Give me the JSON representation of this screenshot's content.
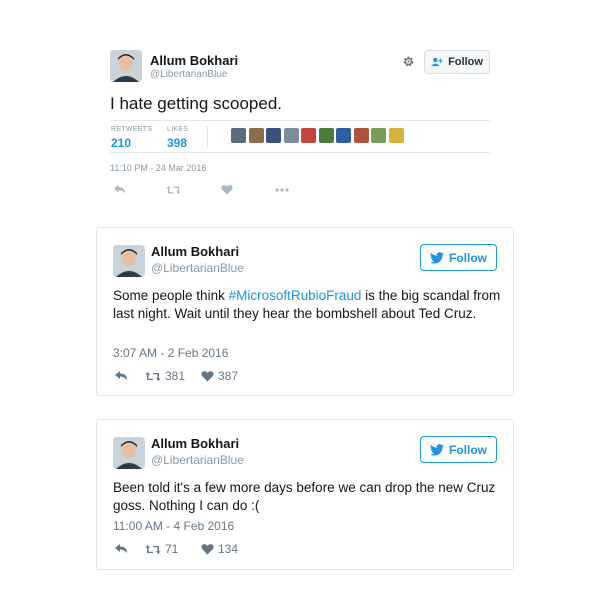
{
  "tweet_main": {
    "author": {
      "name": "Allum Bokhari",
      "handle": "@LibertarianBlue"
    },
    "follow_label": "Follow",
    "text": "I hate getting scooped.",
    "stats": {
      "retweets_label": "RETWEETS",
      "retweets_value": "210",
      "likes_label": "LIKES",
      "likes_value": "398"
    },
    "liker_avatar_colors": [
      "#5a6b7a",
      "#8a6d4c",
      "#3f4f7c",
      "#7b8c9d",
      "#c4443e",
      "#4c7a3c",
      "#2f5f9f",
      "#b0533b",
      "#7b9a55",
      "#d4b33a"
    ],
    "timestamp": "11:10 PM - 24 Mar 2016",
    "icons": [
      "reply-icon",
      "retweet-icon",
      "like-icon",
      "more-icon"
    ]
  },
  "tweet_2": {
    "author": {
      "name": "Allum Bokhari",
      "handle": "@LibertarianBlue"
    },
    "follow_label": "Follow",
    "text_before": "Some people think ",
    "hashtag": "#MicrosoftRubioFraud",
    "text_after": " is the big scandal from last night. Wait until they hear the bombshell about Ted Cruz.",
    "timestamp": "3:07 AM - 2 Feb 2016",
    "retweet_count": "381",
    "like_count": "387"
  },
  "tweet_3": {
    "author": {
      "name": "Allum Bokhari",
      "handle": "@LibertarianBlue"
    },
    "follow_label": "Follow",
    "text": "Been told it's a few more days before we can drop the new Cruz goss. Nothing I can do :(",
    "timestamp": "11:00 AM - 4 Feb 2016",
    "retweet_count": "71",
    "like_count": "134"
  },
  "colors": {
    "twitter_blue": "#1b95e0",
    "muted_text": "#8899a6",
    "border": "#e1e8ed"
  }
}
